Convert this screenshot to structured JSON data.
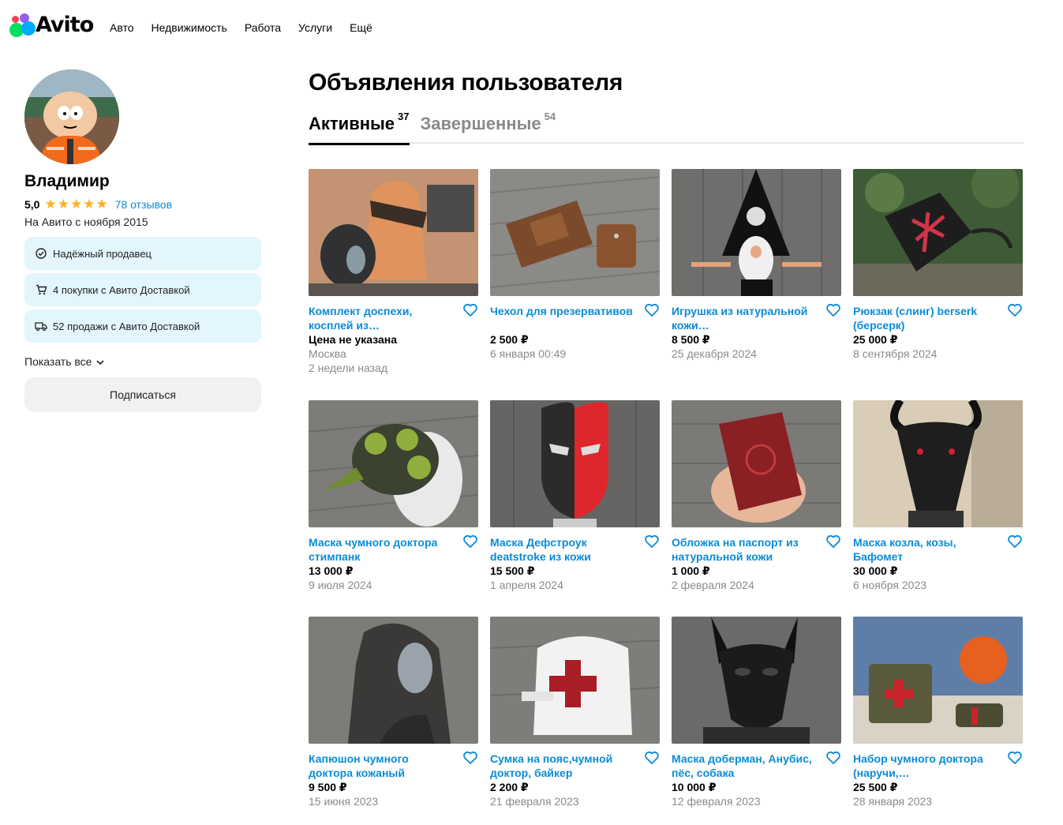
{
  "header": {
    "logo_text": "Avito",
    "nav": [
      "Авто",
      "Недвижимость",
      "Работа",
      "Услуги",
      "Ещё"
    ]
  },
  "profile": {
    "name": "Владимир",
    "rating": "5,0",
    "stars": "★★★★★",
    "reviews": "78 отзывов",
    "since": "На Авито с ноября 2015",
    "badges": [
      {
        "icon": "check-circle-icon",
        "label": "Надёжный продавец"
      },
      {
        "icon": "cart-icon",
        "label": "4 покупки с Авито Доставкой"
      },
      {
        "icon": "truck-icon",
        "label": "52 продажи с Авито Доставкой"
      }
    ],
    "show_all": "Показать все",
    "subscribe": "Подписаться"
  },
  "main": {
    "title": "Объявления пользователя",
    "tabs": [
      {
        "label": "Активные",
        "count": "37"
      },
      {
        "label": "Завершенные",
        "count": "54"
      }
    ]
  },
  "colors": {
    "link": "#0a8bd8",
    "star": "#ffb021",
    "badge_bg": "#e3f5fd",
    "button_bg": "#f2f1f0"
  },
  "listings": [
    {
      "title": "Комплект доспехи, косплей из…",
      "price": "Цена не указана",
      "location": "Москва",
      "date": "2 недели назад"
    },
    {
      "title": "Чехол для презервативов",
      "price": "2 500 ₽",
      "date": "6 января 00:49"
    },
    {
      "title": "Игрушка из натуральной кожи…",
      "price": "8 500 ₽",
      "date": "25 декабря 2024"
    },
    {
      "title": "Рюкзак (слинг) berserk (берсерк)",
      "price": "25 000 ₽",
      "date": "8 сентября 2024"
    },
    {
      "title": "Маска чумного доктора стимпанк",
      "price": "13 000 ₽",
      "date": "9 июля 2024"
    },
    {
      "title": "Маска Дефстроук deatstroke из кожи",
      "price": "15 500 ₽",
      "date": "1 апреля 2024"
    },
    {
      "title": "Обложка на паспорт из натуральной кожи",
      "price": "1 000 ₽",
      "date": "2 февраля 2024"
    },
    {
      "title": "Маска козла, козы, Бафомет",
      "price": "30 000 ₽",
      "date": "6 ноября 2023"
    },
    {
      "title": "Капюшон чумного доктора кожаный",
      "price": "9 500 ₽",
      "date": "15 июня 2023"
    },
    {
      "title": "Сумка на пояс,чумной доктор, байкер",
      "price": "2 200 ₽",
      "date": "21 февраля 2023"
    },
    {
      "title": "Маска доберман, Анубис, пёс, собака",
      "price": "10 000 ₽",
      "date": "12 февраля 2023"
    },
    {
      "title": "Набор чумного доктора (наручи,…",
      "price": "25 500 ₽",
      "date": "28 января 2023"
    }
  ]
}
